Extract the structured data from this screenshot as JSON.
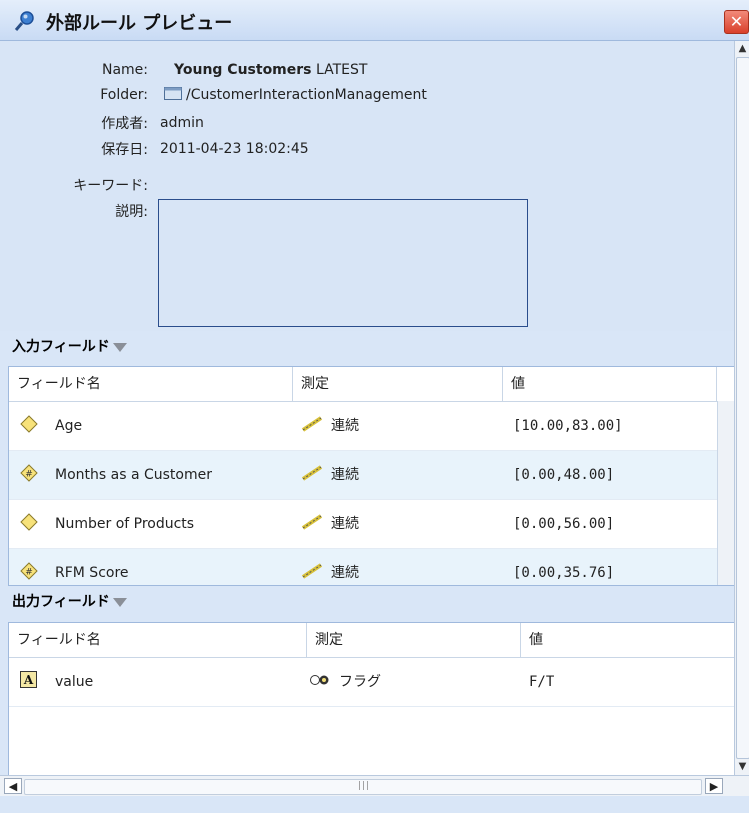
{
  "window": {
    "title": "外部ルール プレビュー",
    "icons": {
      "title": "magnifier-rule-icon",
      "close": "close-icon"
    },
    "close_glyph": "✕"
  },
  "info": {
    "name_label": "Name:",
    "name_value": "Young Customers",
    "name_version": "LATEST",
    "folder_label": "Folder:",
    "folder_value": "/CustomerInteractionManagement",
    "author_label": "作成者:",
    "author_value": "admin",
    "saved_label": "保存日:",
    "saved_value": "2011-04-23 18:02:45",
    "keywords_label": "キーワード:",
    "description_label": "説明:"
  },
  "input_fields": {
    "header": "入力フィールド",
    "columns": [
      "フィールド名",
      "測定",
      "値"
    ],
    "rows": [
      {
        "icon": "diamond-field-icon",
        "name": "Age",
        "measure": "連続",
        "value": "[10.00,83.00]"
      },
      {
        "icon": "hash-diamond-field-icon",
        "name": "Months as a Customer",
        "measure": "連続",
        "value": "[0.00,48.00]"
      },
      {
        "icon": "diamond-field-icon",
        "name": "Number of Products",
        "measure": "連続",
        "value": "[0.00,56.00]"
      },
      {
        "icon": "hash-diamond-field-icon",
        "name": "RFM Score",
        "measure": "連続",
        "value": "[0.00,35.76]"
      }
    ]
  },
  "output_fields": {
    "header": "出力フィールド",
    "columns": [
      "フィールド名",
      "測定",
      "値"
    ],
    "rows": [
      {
        "icon": "string-field-icon",
        "name": "value",
        "measure": "フラグ",
        "value": "F/T"
      }
    ]
  },
  "colors": {
    "panel": "#d8e5f6",
    "row_alt": "#e8f3fb",
    "desc_border": "#2a4d8c",
    "close": "#d9402b"
  }
}
